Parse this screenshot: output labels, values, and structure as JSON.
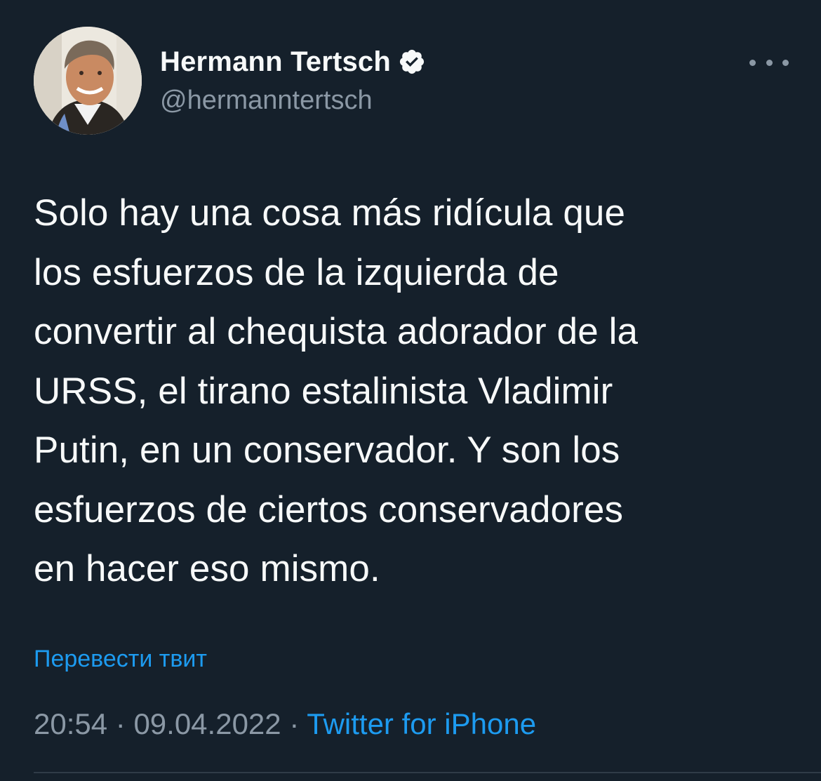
{
  "author": {
    "display_name": "Hermann Tertsch",
    "handle": "@hermanntertsch",
    "verified_icon": "verified-badge-icon"
  },
  "menu": {
    "more_icon": "more-horizontal-icon"
  },
  "tweet": {
    "lines": [
      "Solo hay una cosa más ridícula que",
      "los esfuerzos de la izquierda de",
      "convertir al chequista adorador de la",
      "URSS, el tirano estalinista Vladimir",
      "Putin, en un conservador. Y son los",
      "esfuerzos de ciertos conservadores",
      "en hacer eso mismo."
    ]
  },
  "translate_label": "Перевести твит",
  "meta": {
    "time": "20:54",
    "separator": " · ",
    "date": "09.04.2022",
    "source": "Twitter for iPhone"
  },
  "colors": {
    "background": "#15202b",
    "text": "#f7f9f9",
    "secondary": "#8b98a5",
    "accent": "#1d9bf0"
  }
}
